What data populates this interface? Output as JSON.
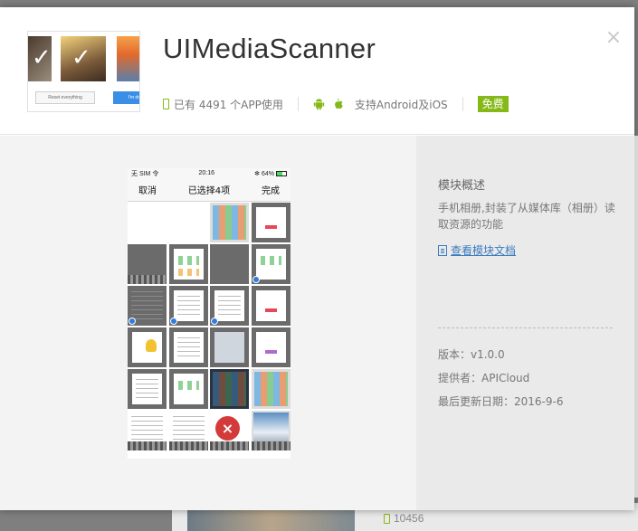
{
  "backdrop": {
    "download_count": "10456"
  },
  "module": {
    "title": "UIMediaScanner",
    "logo_buttons": {
      "left": "Reset everything",
      "right": "I'm done"
    },
    "meta": {
      "installs": "已有 4491 个APP使用",
      "platforms": "支持Android及iOS",
      "price_badge": "免费"
    }
  },
  "preview": {
    "status_left": "无 SIM 令",
    "status_time": "20:16",
    "status_right": "✻ 64%",
    "nav_cancel": "取消",
    "nav_title": "已选择4项",
    "nav_done": "完成"
  },
  "sidebar": {
    "overview_title": "模块概述",
    "description": "手机相册,封装了从媒体库（相册）读取资源的功能",
    "doc_link": "查看模块文档",
    "version": "版本：v1.0.0",
    "provider": "提供者：APICloud",
    "updated": "最后更新日期：2016-9-6"
  },
  "colors": {
    "accent_green": "#86b918",
    "link_blue": "#3b7bbf",
    "delete_red": "#d33b3b"
  },
  "icons": [
    "close-icon",
    "phone-icon",
    "android-icon",
    "apple-icon",
    "document-icon",
    "delete-icon",
    "check-icon"
  ]
}
